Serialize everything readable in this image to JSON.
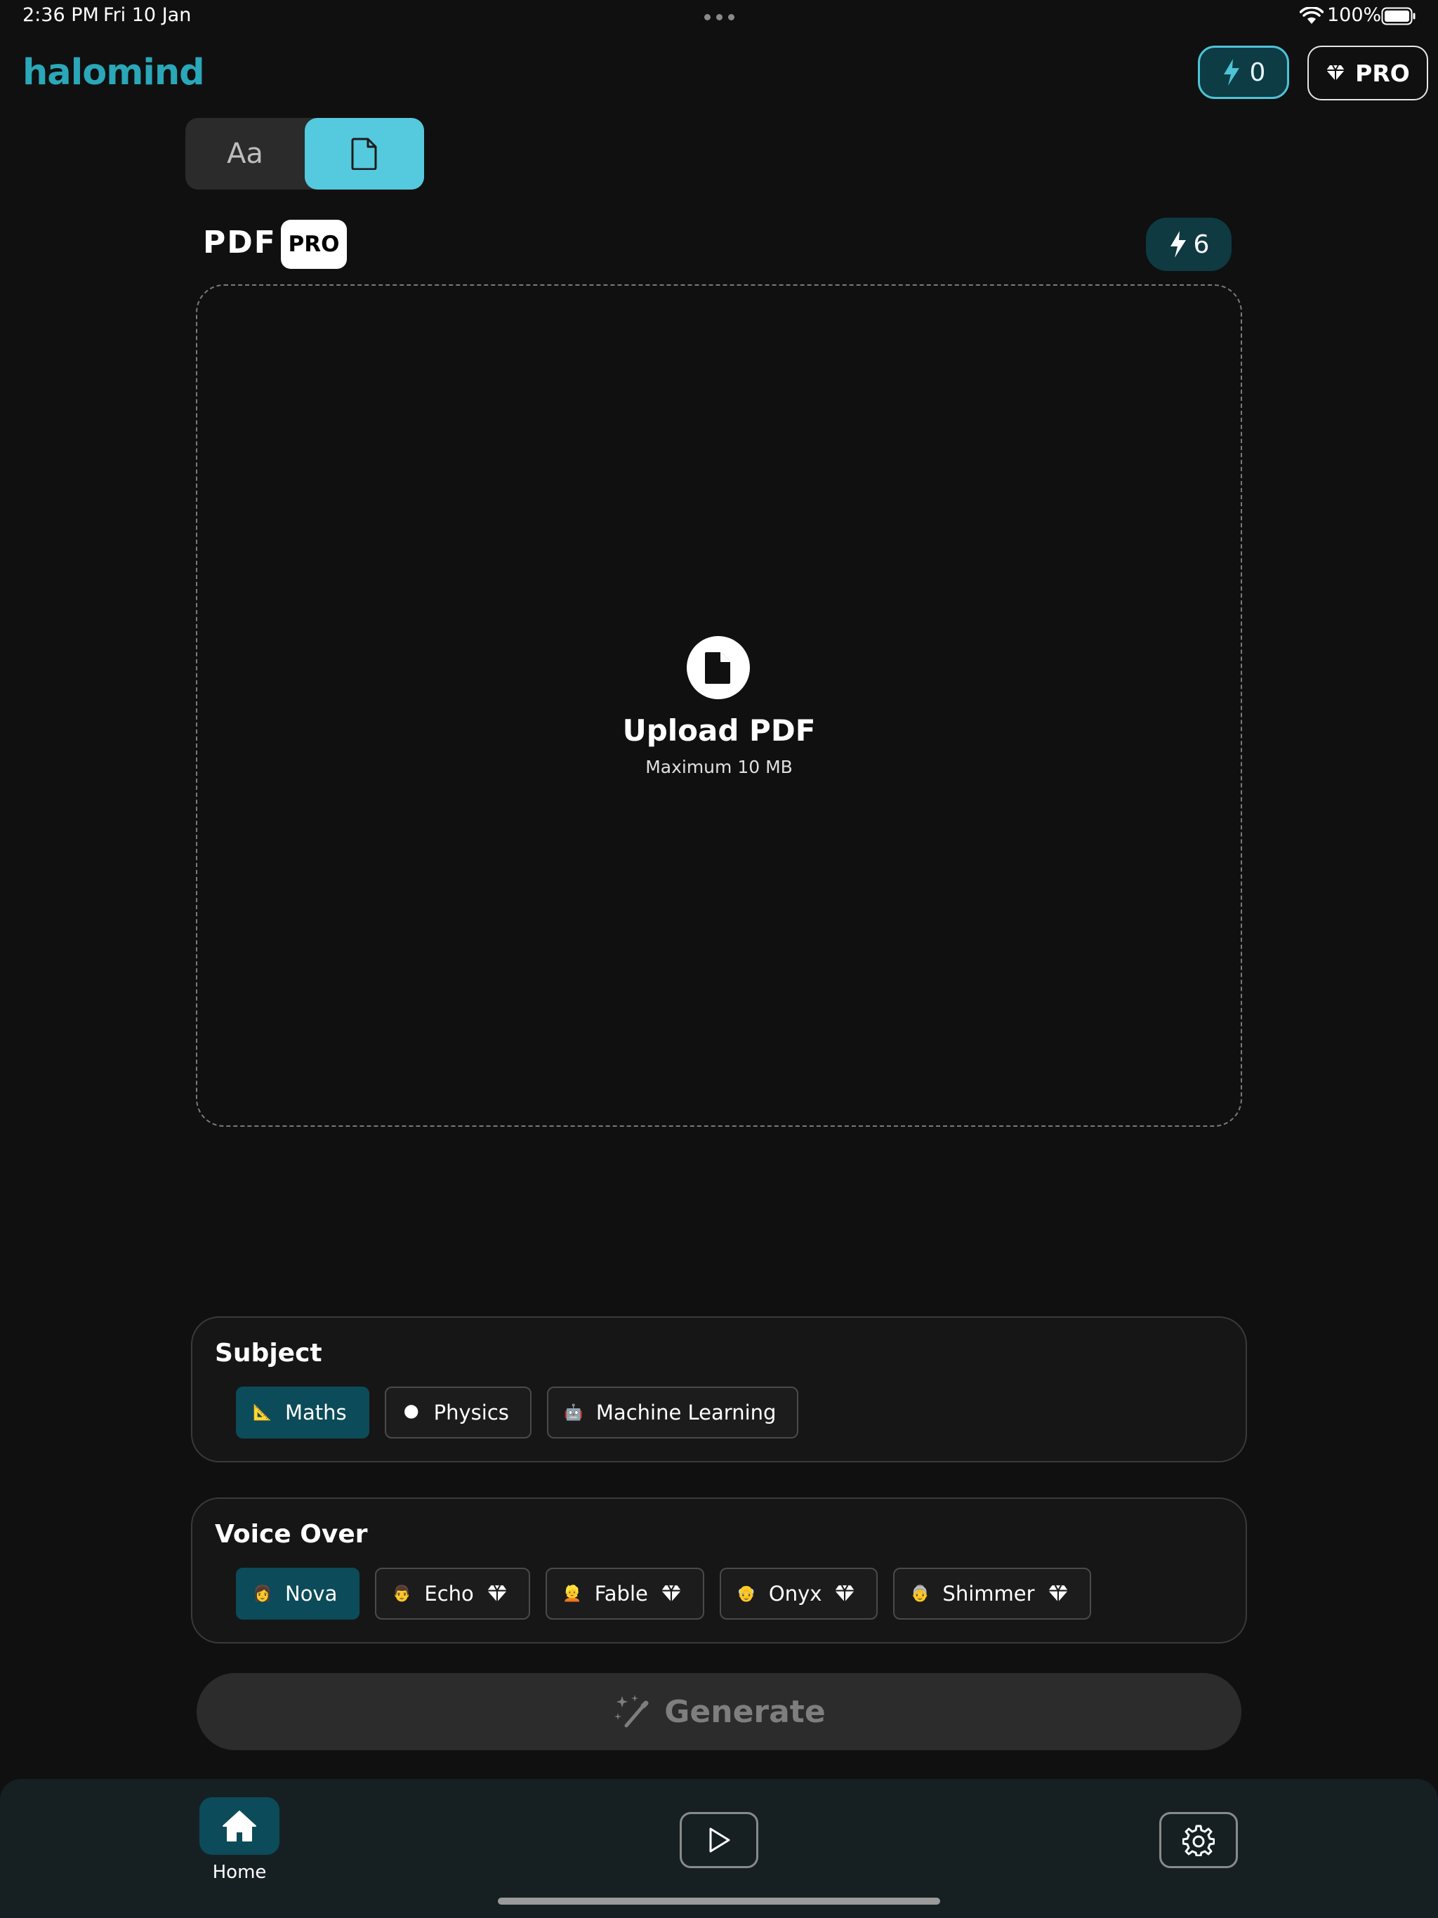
{
  "status_bar": {
    "time": "2:36 PM",
    "date": "Fri 10 Jan",
    "battery": "100%",
    "icons": [
      "wifi-icon",
      "battery-icon",
      "more-dots-icon"
    ]
  },
  "header": {
    "logo": "halomind",
    "credits": "0",
    "pro_label": "PRO"
  },
  "mode_toggle": {
    "text_label": "Aa",
    "selected": "pdf"
  },
  "pdf_section": {
    "title": "PDF",
    "pro_badge": "PRO",
    "cost": "6",
    "upload_title": "Upload PDF",
    "upload_subtitle": "Maximum 10 MB"
  },
  "subject": {
    "title": "Subject",
    "options": [
      {
        "label": "Maths",
        "emoji": "📐",
        "selected": true
      },
      {
        "label": "Physics",
        "emoji": "🌑",
        "selected": false
      },
      {
        "label": "Machine Learning",
        "emoji": "🤖",
        "selected": false
      }
    ]
  },
  "voice_over": {
    "title": "Voice Over",
    "options": [
      {
        "label": "Nova",
        "emoji": "👩",
        "selected": true,
        "pro": false
      },
      {
        "label": "Echo",
        "emoji": "👨",
        "selected": false,
        "pro": true
      },
      {
        "label": "Fable",
        "emoji": "👱",
        "selected": false,
        "pro": true
      },
      {
        "label": "Onyx",
        "emoji": "👴",
        "selected": false,
        "pro": true
      },
      {
        "label": "Shimmer",
        "emoji": "👵",
        "selected": false,
        "pro": true
      }
    ]
  },
  "generate": {
    "label": "Generate"
  },
  "bottom_nav": {
    "home_label": "Home"
  },
  "colors": {
    "accent": "#55c9dd",
    "selected_chip": "#0c4b59",
    "logo": "#2aa7b8"
  }
}
